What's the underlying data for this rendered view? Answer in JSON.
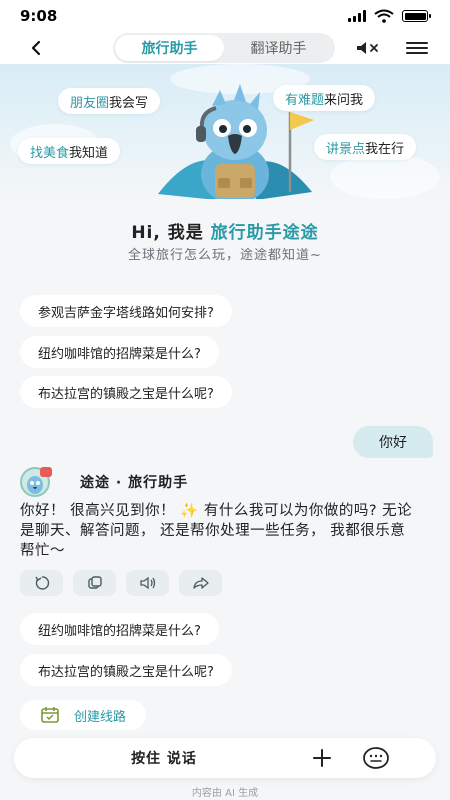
{
  "status_bar": {
    "time": "9:08"
  },
  "nav": {
    "tabs": [
      {
        "label": "旅行助手",
        "active": true
      },
      {
        "label": "翻译助手",
        "active": false
      }
    ]
  },
  "hero": {
    "bubbles": [
      {
        "highlight": "朋友圈",
        "rest": "我会写"
      },
      {
        "highlight": "有难题",
        "rest": "来问我"
      },
      {
        "highlight": "找美食",
        "rest": "我知道"
      },
      {
        "highlight": "讲景点",
        "rest": "我在行"
      }
    ]
  },
  "greeting": {
    "prefix": "Hi, 我是 ",
    "name": "旅行助手途途",
    "subtitle": "全球旅行怎么玩，途途都知道~"
  },
  "suggestions": [
    "参观吉萨金字塔线路如何安排?",
    "纽约咖啡馆的招牌菜是什么?",
    "布达拉宫的镇殿之宝是什么呢?"
  ],
  "user_message": "你好",
  "bot": {
    "name": "途途 · 旅行助手",
    "message": "你好！ 很高兴见到你！ ✨ 有什么我可以为你做的吗? 无论是聊天、解答问题， 还是帮你处理一些任务， 我都很乐意帮忙〜"
  },
  "followups": [
    "纽约咖啡馆的招牌菜是什么?",
    "布达拉宫的镇殿之宝是什么呢?"
  ],
  "create_route_label": "创建线路",
  "input": {
    "hold_label": "按住 说话"
  },
  "disclaimer": "内容由 AI 生成",
  "colors": {
    "accent": "#2a9aa6",
    "user_bubble": "#d6ebef"
  }
}
